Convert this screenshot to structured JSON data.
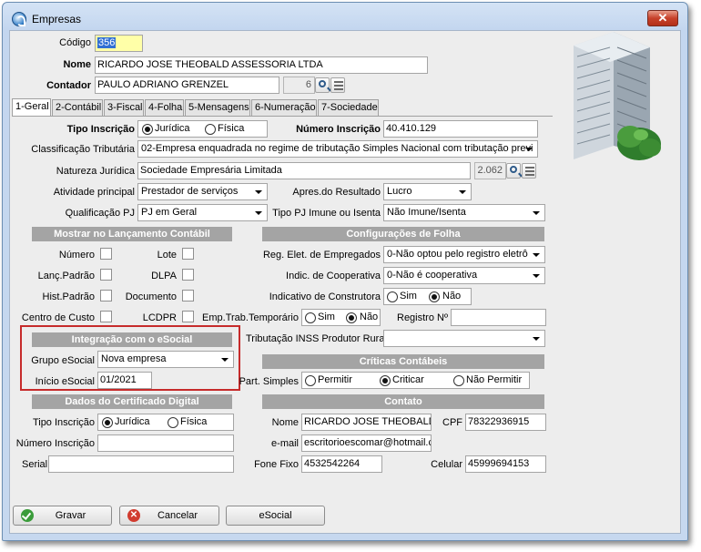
{
  "window": {
    "title": "Empresas",
    "close_label": "✕"
  },
  "header": {
    "codigo_label": "Código",
    "codigo_value": "356",
    "nome_label": "Nome",
    "nome_value": "RICARDO JOSE THEOBALD ASSESSORIA LTDA",
    "contador_label": "Contador",
    "contador_value": "PAULO ADRIANO GRENZEL",
    "contador_code": "6"
  },
  "tabs": [
    {
      "label": "1-Geral"
    },
    {
      "label": "2-Contábil"
    },
    {
      "label": "3-Fiscal"
    },
    {
      "label": "4-Folha"
    },
    {
      "label": "5-Mensagens"
    },
    {
      "label": "6-Numeração"
    },
    {
      "label": "7-Sociedade"
    }
  ],
  "geral": {
    "tipo_inscricao_label": "Tipo Inscrição",
    "opt_juridica": "Jurídica",
    "opt_fisica": "Física",
    "numero_inscricao_label": "Número Inscrição",
    "numero_inscricao_value": "40.410.129",
    "classificacao_label": "Classificação Tributária",
    "classificacao_value": "02-Empresa enquadrada no regime de tributação Simples Nacional com tributação previ",
    "natureza_label": "Natureza Jurídica",
    "natureza_value": "Sociedade Empresária Limitada",
    "natureza_code": "2.062",
    "atividade_label": "Atividade principal",
    "atividade_value": "Prestador de serviços",
    "apres_label": "Apres.do Resultado",
    "apres_value": "Lucro",
    "qualificacao_label": "Qualificação PJ",
    "qualificacao_value": "PJ em Geral",
    "tipo_pj_label": "Tipo PJ Imune ou Isenta",
    "tipo_pj_value": "Não Imune/Isenta"
  },
  "lancamento": {
    "title": "Mostrar no Lançamento Contábil",
    "numero": "Número",
    "lote": "Lote",
    "lanc_padrao": "Lanç.Padrão",
    "dlpa": "DLPA",
    "hist_padrao": "Hist.Padrão",
    "documento": "Documento",
    "centro_custo": "Centro de Custo",
    "lcdpr": "LCDPR"
  },
  "folha": {
    "title": "Configurações de Folha",
    "reg_label": "Reg. Elet. de Empregados",
    "reg_value": "0-Não optou pelo registro eletrô",
    "coop_label": "Indic. de Cooperativa",
    "coop_value": "0-Não é cooperativa",
    "constr_label": "Indicativo de Construtora",
    "opt_sim": "Sim",
    "opt_nao": "Não",
    "temp_label": "Emp.Trab.Temporário",
    "registro_label": "Registro Nº",
    "tributacao_label": "Tributação INSS Produtor Rural"
  },
  "esocial": {
    "title": "Integração com o eSocial",
    "grupo_label": "Grupo eSocial",
    "grupo_value": "Nova empresa",
    "inicio_label": "Início eSocial",
    "inicio_value": "01/2021"
  },
  "criticas": {
    "title": "Críticas Contábeis",
    "part_label": "Part. Simples",
    "opt_permitir": "Permitir",
    "opt_criticar": "Criticar",
    "opt_nao_permitir": "Não Permitir"
  },
  "certificado": {
    "title": "Dados do Certificado Digital",
    "tipo_label": "Tipo Inscrição",
    "opt_juridica": "Jurídica",
    "opt_fisica": "Física",
    "numero_label": "Número Inscrição",
    "serial_label": "Serial"
  },
  "contato": {
    "title": "Contato",
    "nome_label": "Nome",
    "nome_value": "RICARDO JOSE THEOBALD",
    "cpf_label": "CPF",
    "cpf_value": "78322936915",
    "email_label": "e-mail",
    "email_value": "escritorioescomar@hotmail.co",
    "fone_label": "Fone Fixo",
    "fone_value": "4532542264",
    "celular_label": "Celular",
    "celular_value": "45999694153"
  },
  "buttons": {
    "gravar": "Gravar",
    "cancelar": "Cancelar",
    "esocial": "eSocial"
  },
  "colors": {
    "section_bg": "#a4a4a4",
    "highlight_field": "#ffffa8",
    "esocial_border": "#c62b2b"
  }
}
